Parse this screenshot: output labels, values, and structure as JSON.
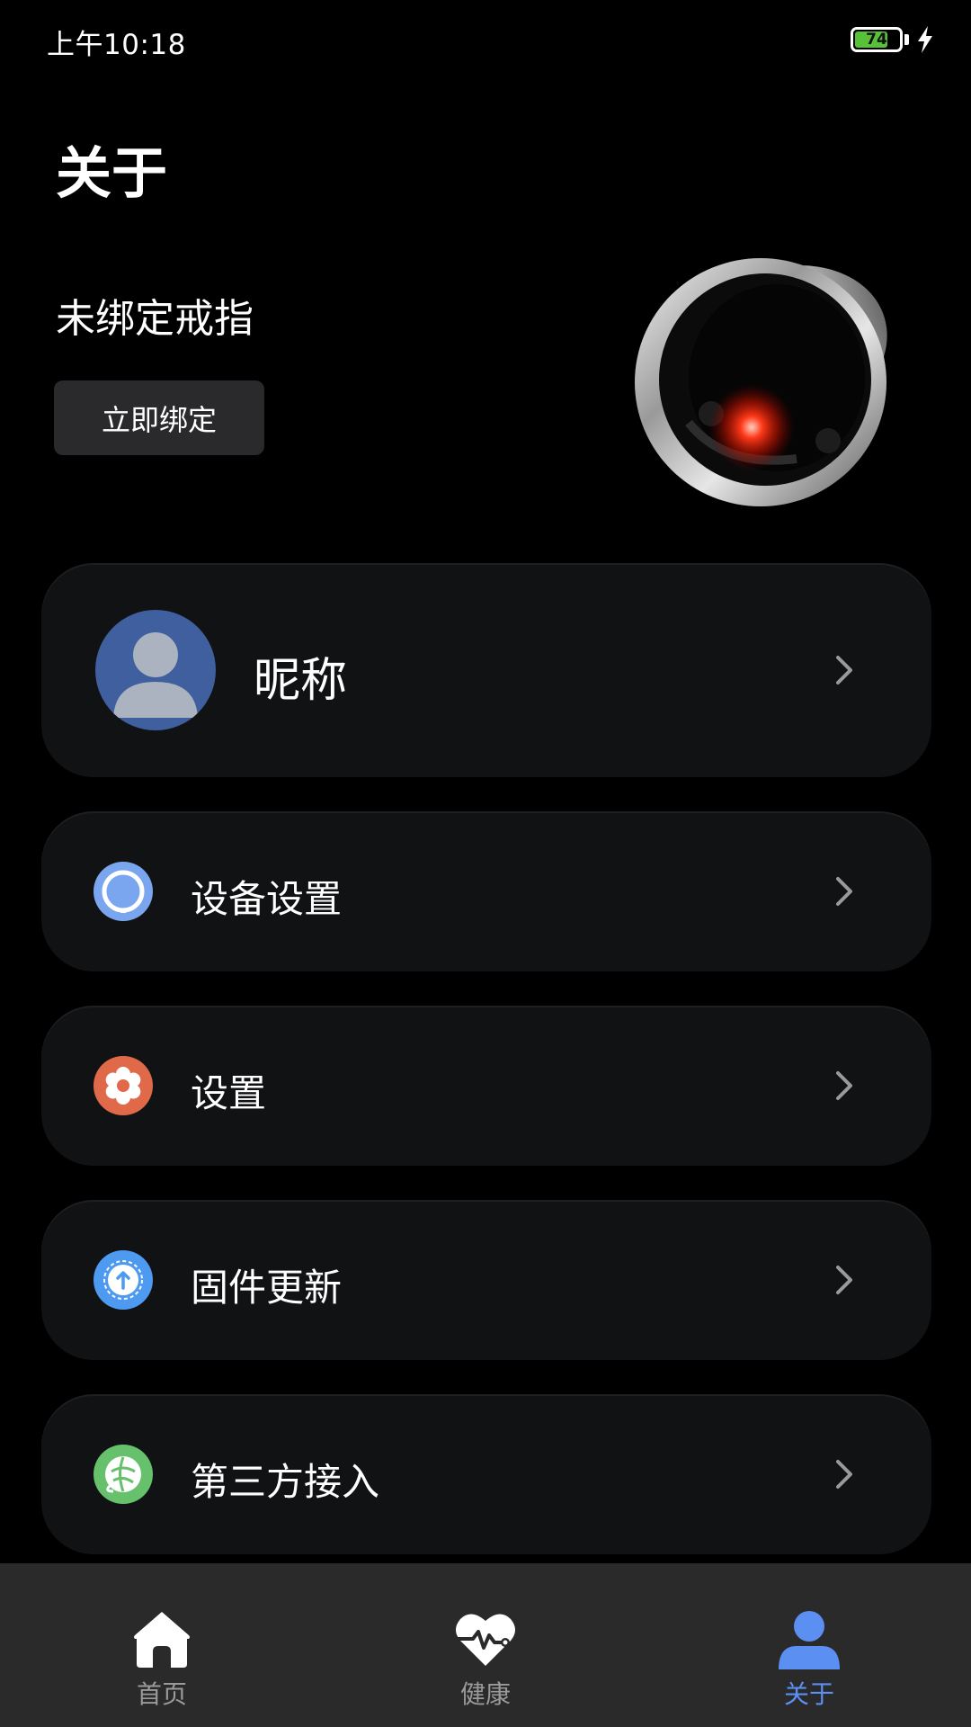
{
  "status_bar": {
    "time": "上午10:18",
    "battery_level": "74",
    "battery_fraction": 0.74,
    "charging": true
  },
  "header": {
    "title": "关于"
  },
  "device": {
    "status": "未绑定戒指",
    "bind_button_label": "立即绑定",
    "image_icon": "smart-ring"
  },
  "profile": {
    "nickname": "昵称",
    "avatar_icon": "default-user-avatar"
  },
  "menu": {
    "items": [
      {
        "label": "设备设置",
        "icon": "ring-device-icon",
        "color": "#7aa6f0"
      },
      {
        "label": "设置",
        "icon": "gear-icon",
        "color": "#e0694a"
      },
      {
        "label": "固件更新",
        "icon": "firmware-update-icon",
        "color": "#4d9af0"
      },
      {
        "label": "第三方接入",
        "icon": "third-party-icon",
        "color": "#66c06c"
      }
    ]
  },
  "tabbar": {
    "tabs": [
      {
        "label": "首页",
        "icon": "home-icon",
        "active": false
      },
      {
        "label": "健康",
        "icon": "heart-pulse-icon",
        "active": false
      },
      {
        "label": "关于",
        "icon": "person-icon",
        "active": true
      }
    ],
    "active_color": "#5b8ff2",
    "inactive_color": "#9a9a9a"
  }
}
